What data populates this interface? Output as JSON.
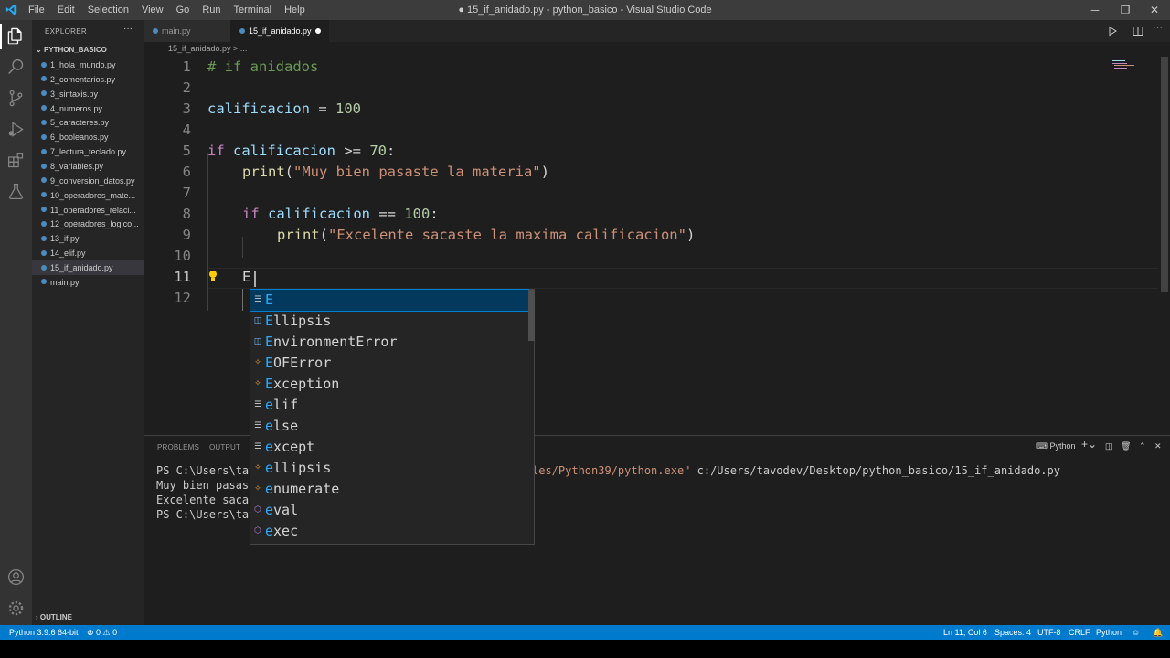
{
  "window": {
    "title": "● 15_if_anidado.py - python_basico - Visual Studio Code",
    "menu": [
      "File",
      "Edit",
      "Selection",
      "View",
      "Go",
      "Run",
      "Terminal",
      "Help"
    ],
    "controls": {
      "minimize": "─",
      "maximize": "❐",
      "close": "✕"
    }
  },
  "sidebar": {
    "header": "EXPLORER",
    "more": "···",
    "folder": "PYTHON_BASICO",
    "files": [
      {
        "name": "1_hola_mundo.py"
      },
      {
        "name": "2_comentarios.py"
      },
      {
        "name": "3_sintaxis.py"
      },
      {
        "name": "4_numeros.py"
      },
      {
        "name": "5_caracteres.py"
      },
      {
        "name": "6_booleanos.py"
      },
      {
        "name": "7_lectura_teclado.py"
      },
      {
        "name": "8_variables.py"
      },
      {
        "name": "9_conversion_datos.py"
      },
      {
        "name": "10_operadores_mate..."
      },
      {
        "name": "11_operadores_relaci..."
      },
      {
        "name": "12_operadores_logico..."
      },
      {
        "name": "13_if.py"
      },
      {
        "name": "14_elif.py"
      },
      {
        "name": "15_if_anidado.py",
        "active": true
      },
      {
        "name": "main.py"
      }
    ],
    "outline": "OUTLINE"
  },
  "tabs": [
    {
      "label": "main.py",
      "active": false
    },
    {
      "label": "15_if_anidado.py",
      "active": true,
      "modified": true
    }
  ],
  "breadcrumb": "15_if_anidado.py > ...",
  "editor": {
    "line_numbers": [
      "1",
      "2",
      "3",
      "4",
      "5",
      "6",
      "7",
      "8",
      "9",
      "10",
      "11",
      "12"
    ],
    "current_line": "11",
    "lines": {
      "l1": "# if anidados",
      "l3_var": "calificacion",
      "l3_op": " = ",
      "l3_num": "100",
      "l5_kw": "if",
      "l5_var": " calificacion",
      "l5_op": " >= ",
      "l5_num": "70",
      "l5_end": ":",
      "l6_fn": "print",
      "l6_open": "(",
      "l6_str": "\"Muy bien pasaste la materia\"",
      "l6_close": ")",
      "l8_kw": "if",
      "l8_var": " calificacion",
      "l8_op": " == ",
      "l8_num": "100",
      "l8_end": ":",
      "l9_fn": "print",
      "l9_open": "(",
      "l9_str": "\"Excelente sacaste la maxima calificacion\"",
      "l9_close": ")",
      "l11": "E:"
    }
  },
  "suggestions": {
    "items": [
      {
        "match": "E",
        "rest": "",
        "kind": "keyword",
        "selected": true
      },
      {
        "match": "E",
        "rest": "llipsis",
        "kind": "variable"
      },
      {
        "match": "E",
        "rest": "nvironmentError",
        "kind": "variable"
      },
      {
        "match": "E",
        "rest": "OFError",
        "kind": "class"
      },
      {
        "match": "E",
        "rest": "xception",
        "kind": "class"
      },
      {
        "match": "e",
        "rest": "lif",
        "kind": "keyword"
      },
      {
        "match": "e",
        "rest": "lse",
        "kind": "keyword"
      },
      {
        "match": "e",
        "rest": "xcept",
        "kind": "keyword"
      },
      {
        "match": "e",
        "rest": "llipsis",
        "kind": "class"
      },
      {
        "match": "e",
        "rest": "numerate",
        "kind": "class"
      },
      {
        "match": "e",
        "rest": "val",
        "kind": "function"
      },
      {
        "match": "e",
        "rest": "xec",
        "kind": "function"
      }
    ]
  },
  "panel": {
    "tabs": [
      "PROBLEMS",
      "OUTPUT"
    ],
    "terminal_name": "Python",
    "terminal": {
      "l1_a": "PS C:\\Users\\tav",
      "l1_str": "les/Python39/python.exe\"",
      "l1_b": " c:/Users/tavodev/Desktop/python_basico/15_if_anidado.py",
      "l2": "Muy bien pasast",
      "l3": "Excelente sacas",
      "l4": "PS C:\\Users\\tav"
    }
  },
  "statusbar": {
    "interpreter": "Python 3.9.6 64-bit",
    "problems": "⊗ 0 ⚠ 0",
    "position": "Ln 11, Col 6",
    "spaces": "Spaces: 4",
    "encoding": "UTF-8",
    "eol": "CRLF",
    "language": "Python"
  },
  "colors": {
    "accent": "#007acc",
    "selection": "#04395e",
    "match": "#2aaaff"
  }
}
